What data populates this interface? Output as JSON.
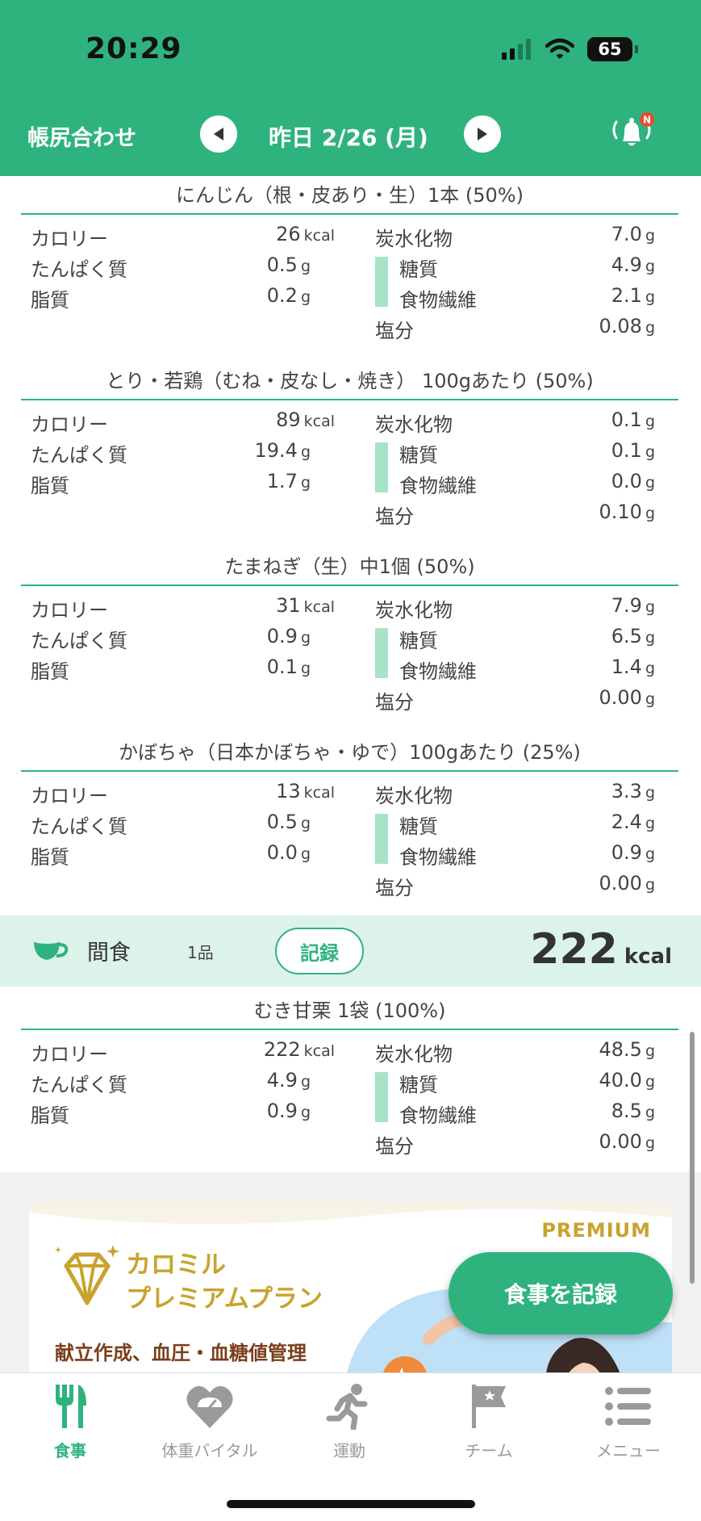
{
  "status_bar": {
    "time": "20:29",
    "battery": "65"
  },
  "header": {
    "title": "帳尻合わせ",
    "date": "昨日 2/26 (月)",
    "notification_badge": "N"
  },
  "labels": {
    "calorie": "カロリー",
    "protein": "たんぱく質",
    "fat": "脂質",
    "carbs": "炭水化物",
    "sugar": "糖質",
    "fiber": "食物繊維",
    "salt": "塩分",
    "kcal_unit": "kcal",
    "g_unit": "g"
  },
  "foods": [
    {
      "title": "にんじん（根・皮あり・生）1本 (50%)",
      "calorie": "26",
      "protein": "0.5",
      "fat": "0.2",
      "carbs": "7.0",
      "sugar": "4.9",
      "fiber": "2.1",
      "salt": "0.08"
    },
    {
      "title": "とり・若鶏（むね・皮なし・焼き） 100gあたり (50%)",
      "calorie": "89",
      "protein": "19.4",
      "fat": "1.7",
      "carbs": "0.1",
      "sugar": "0.1",
      "fiber": "0.0",
      "salt": "0.10"
    },
    {
      "title": "たまねぎ（生）中1個 (50%)",
      "calorie": "31",
      "protein": "0.9",
      "fat": "0.1",
      "carbs": "7.9",
      "sugar": "6.5",
      "fiber": "1.4",
      "salt": "0.00"
    },
    {
      "title": "かぼちゃ（日本かぼちゃ・ゆで）100gあたり (25%)",
      "calorie": "13",
      "protein": "0.5",
      "fat": "0.0",
      "carbs": "3.3",
      "sugar": "2.4",
      "fiber": "0.9",
      "salt": "0.00"
    },
    {
      "title": "むき甘栗 1袋 (100%)",
      "calorie": "222",
      "protein": "4.9",
      "fat": "0.9",
      "carbs": "48.5",
      "sugar": "40.0",
      "fiber": "8.5",
      "salt": "0.00"
    }
  ],
  "snack": {
    "label": "間食",
    "count": "1品",
    "record_button": "記録",
    "kcal": "222",
    "kcal_unit": "kcal"
  },
  "premium": {
    "tag": "PREMIUM",
    "name_line1": "カロミル",
    "name_line2": "プレミアムプラン",
    "description": "献立作成、血圧・血糖値管理"
  },
  "fab_label": "食事を記録",
  "tabs": [
    {
      "label": "食事",
      "icon": "fork-knife-icon"
    },
    {
      "label": "体重バイタル",
      "icon": "heart-scale-icon"
    },
    {
      "label": "運動",
      "icon": "running-icon"
    },
    {
      "label": "チーム",
      "icon": "flag-star-icon"
    },
    {
      "label": "メニュー",
      "icon": "menu-list-icon"
    }
  ],
  "colors": {
    "primary": "#2fb37e",
    "snack_band": "#dcf3ea",
    "premium_gold": "#c8a32e",
    "premium_brown": "#7a3e1c"
  }
}
